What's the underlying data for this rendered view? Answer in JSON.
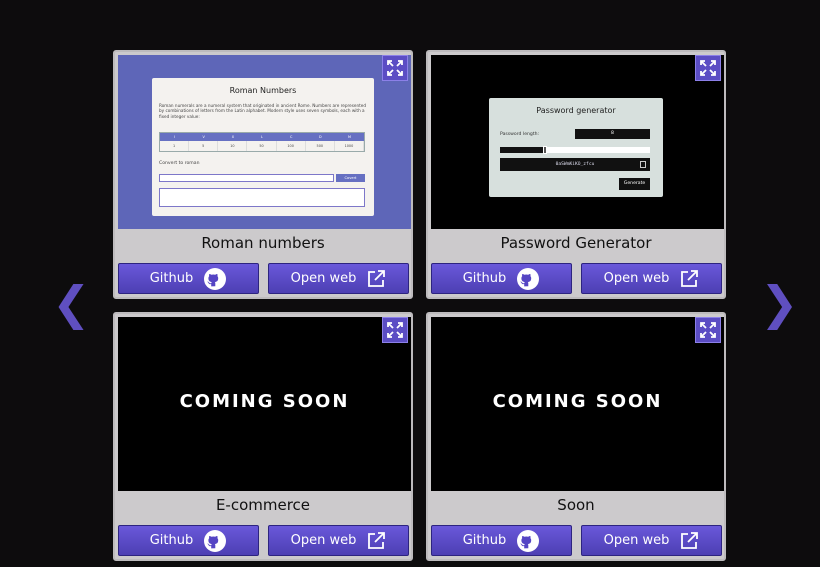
{
  "nav": {
    "prev_label": "❮",
    "next_label": "❯"
  },
  "colors": {
    "background": "#0d0c0d",
    "accent": "#5b4dc4",
    "card": "#cccacc"
  },
  "projects": [
    {
      "title": "Roman numbers",
      "github_label": "Github",
      "web_label": "Open web",
      "preview": {
        "heading": "Roman Numbers",
        "description": "Roman numerals are a numeral system that originated in ancient Rome. Numbers are represented by combinations of letters from the Latin alphabet. Modern style uses seven symbols, each with a fixed integer value:",
        "symbols": [
          "I",
          "V",
          "X",
          "L",
          "C",
          "D",
          "M"
        ],
        "values": [
          "1",
          "5",
          "10",
          "50",
          "100",
          "500",
          "1000"
        ],
        "convert_label": "Convert to roman",
        "convert_button": "Covert"
      }
    },
    {
      "title": "Password Generator",
      "github_label": "Github",
      "web_label": "Open web",
      "preview": {
        "heading": "Password generator",
        "length_label": "Password length:",
        "length_value": "8",
        "strength_fraction": 0.3,
        "generated": "0aSWmKiKO_zfcu",
        "generate_button": "Generate"
      }
    },
    {
      "title": "E-commerce",
      "github_label": "Github",
      "web_label": "Open web",
      "preview_text": "COMING SOON"
    },
    {
      "title": "Soon",
      "github_label": "Github",
      "web_label": "Open web",
      "preview_text": "COMING SOON"
    }
  ]
}
